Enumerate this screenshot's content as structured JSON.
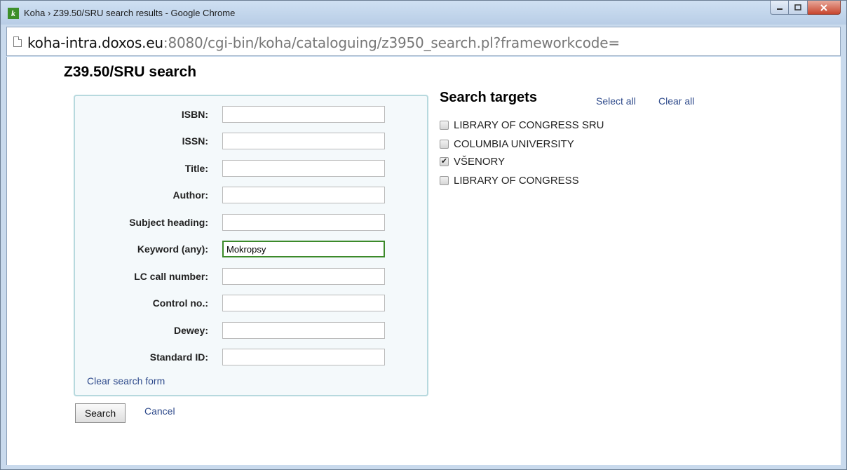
{
  "window": {
    "title": "Koha › Z39.50/SRU search results - Google Chrome",
    "app_icon": "k",
    "controls": {
      "minimize": "minimize-icon",
      "maximize": "maximize-icon",
      "close": "close-icon"
    }
  },
  "address": {
    "url_host": "koha-intra.doxos.eu",
    "url_rest": ":8080/cgi-bin/koha/cataloguing/z3950_search.pl?frameworkcode="
  },
  "page": {
    "title": "Z39.50/SRU search"
  },
  "form": {
    "fields": [
      {
        "label": "ISBN:",
        "value": ""
      },
      {
        "label": "ISSN:",
        "value": ""
      },
      {
        "label": "Title:",
        "value": ""
      },
      {
        "label": "Author:",
        "value": ""
      },
      {
        "label": "Subject heading:",
        "value": ""
      },
      {
        "label": "Keyword (any):",
        "value": "Mokropsy"
      },
      {
        "label": "LC call number:",
        "value": ""
      },
      {
        "label": "Control no.:",
        "value": ""
      },
      {
        "label": "Dewey:",
        "value": ""
      },
      {
        "label": "Standard ID:",
        "value": ""
      }
    ],
    "clear_link": "Clear search form",
    "search_button": "Search",
    "cancel_link": "Cancel"
  },
  "targets": {
    "title": "Search targets",
    "select_all": "Select all",
    "clear_all": "Clear all",
    "items": [
      {
        "name": "LIBRARY OF CONGRESS SRU",
        "checked": false
      },
      {
        "name": "COLUMBIA UNIVERSITY",
        "checked": false
      },
      {
        "name": "VŠENORY",
        "checked": true
      },
      {
        "name": "LIBRARY OF CONGRESS",
        "checked": false
      }
    ]
  },
  "colors": {
    "link": "#2e4a8b",
    "form_border": "#b7d9de",
    "focus_border": "#3c8a2a"
  }
}
